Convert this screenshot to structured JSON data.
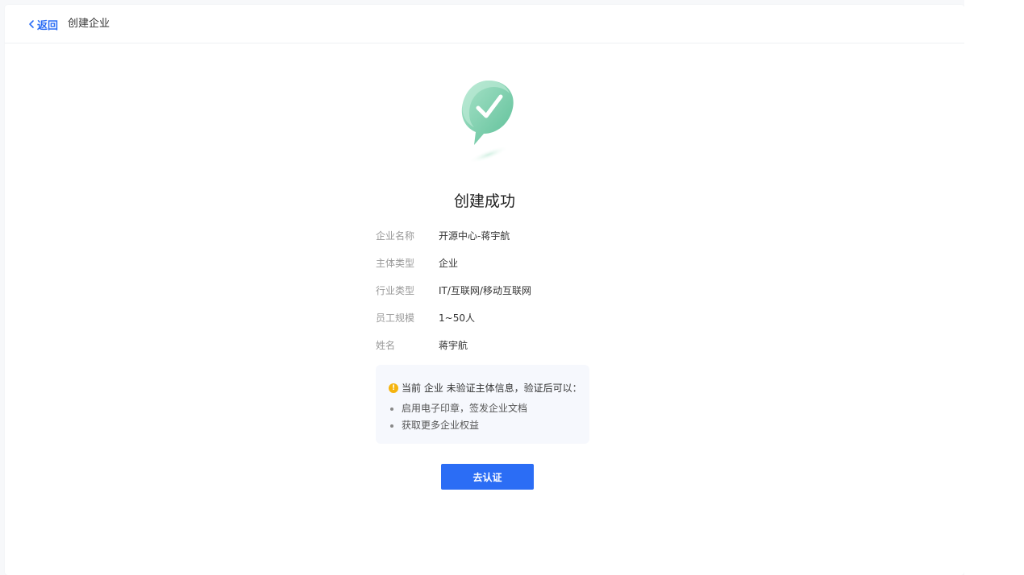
{
  "header": {
    "back_label": "返回",
    "title": "创建企业"
  },
  "success": {
    "title": "创建成功",
    "icon": "check-speech-bubble-icon"
  },
  "info": [
    {
      "label": "企业名称",
      "value": "开源中心-蒋宇航"
    },
    {
      "label": "主体类型",
      "value": "企业"
    },
    {
      "label": "行业类型",
      "value": "IT/互联网/移动互联网"
    },
    {
      "label": "员工规模",
      "value": "1~50人"
    },
    {
      "label": "姓名",
      "value": "蒋宇航"
    }
  ],
  "notice": {
    "text": "当前 企业 未验证主体信息，验证后可以：",
    "items": [
      "启用电子印章，签发企业文档",
      "获取更多企业权益"
    ]
  },
  "actions": {
    "verify_label": "去认证"
  },
  "colors": {
    "primary": "#2b6df5",
    "success_green": "#7fcfb0",
    "warning": "#f5b40f"
  }
}
